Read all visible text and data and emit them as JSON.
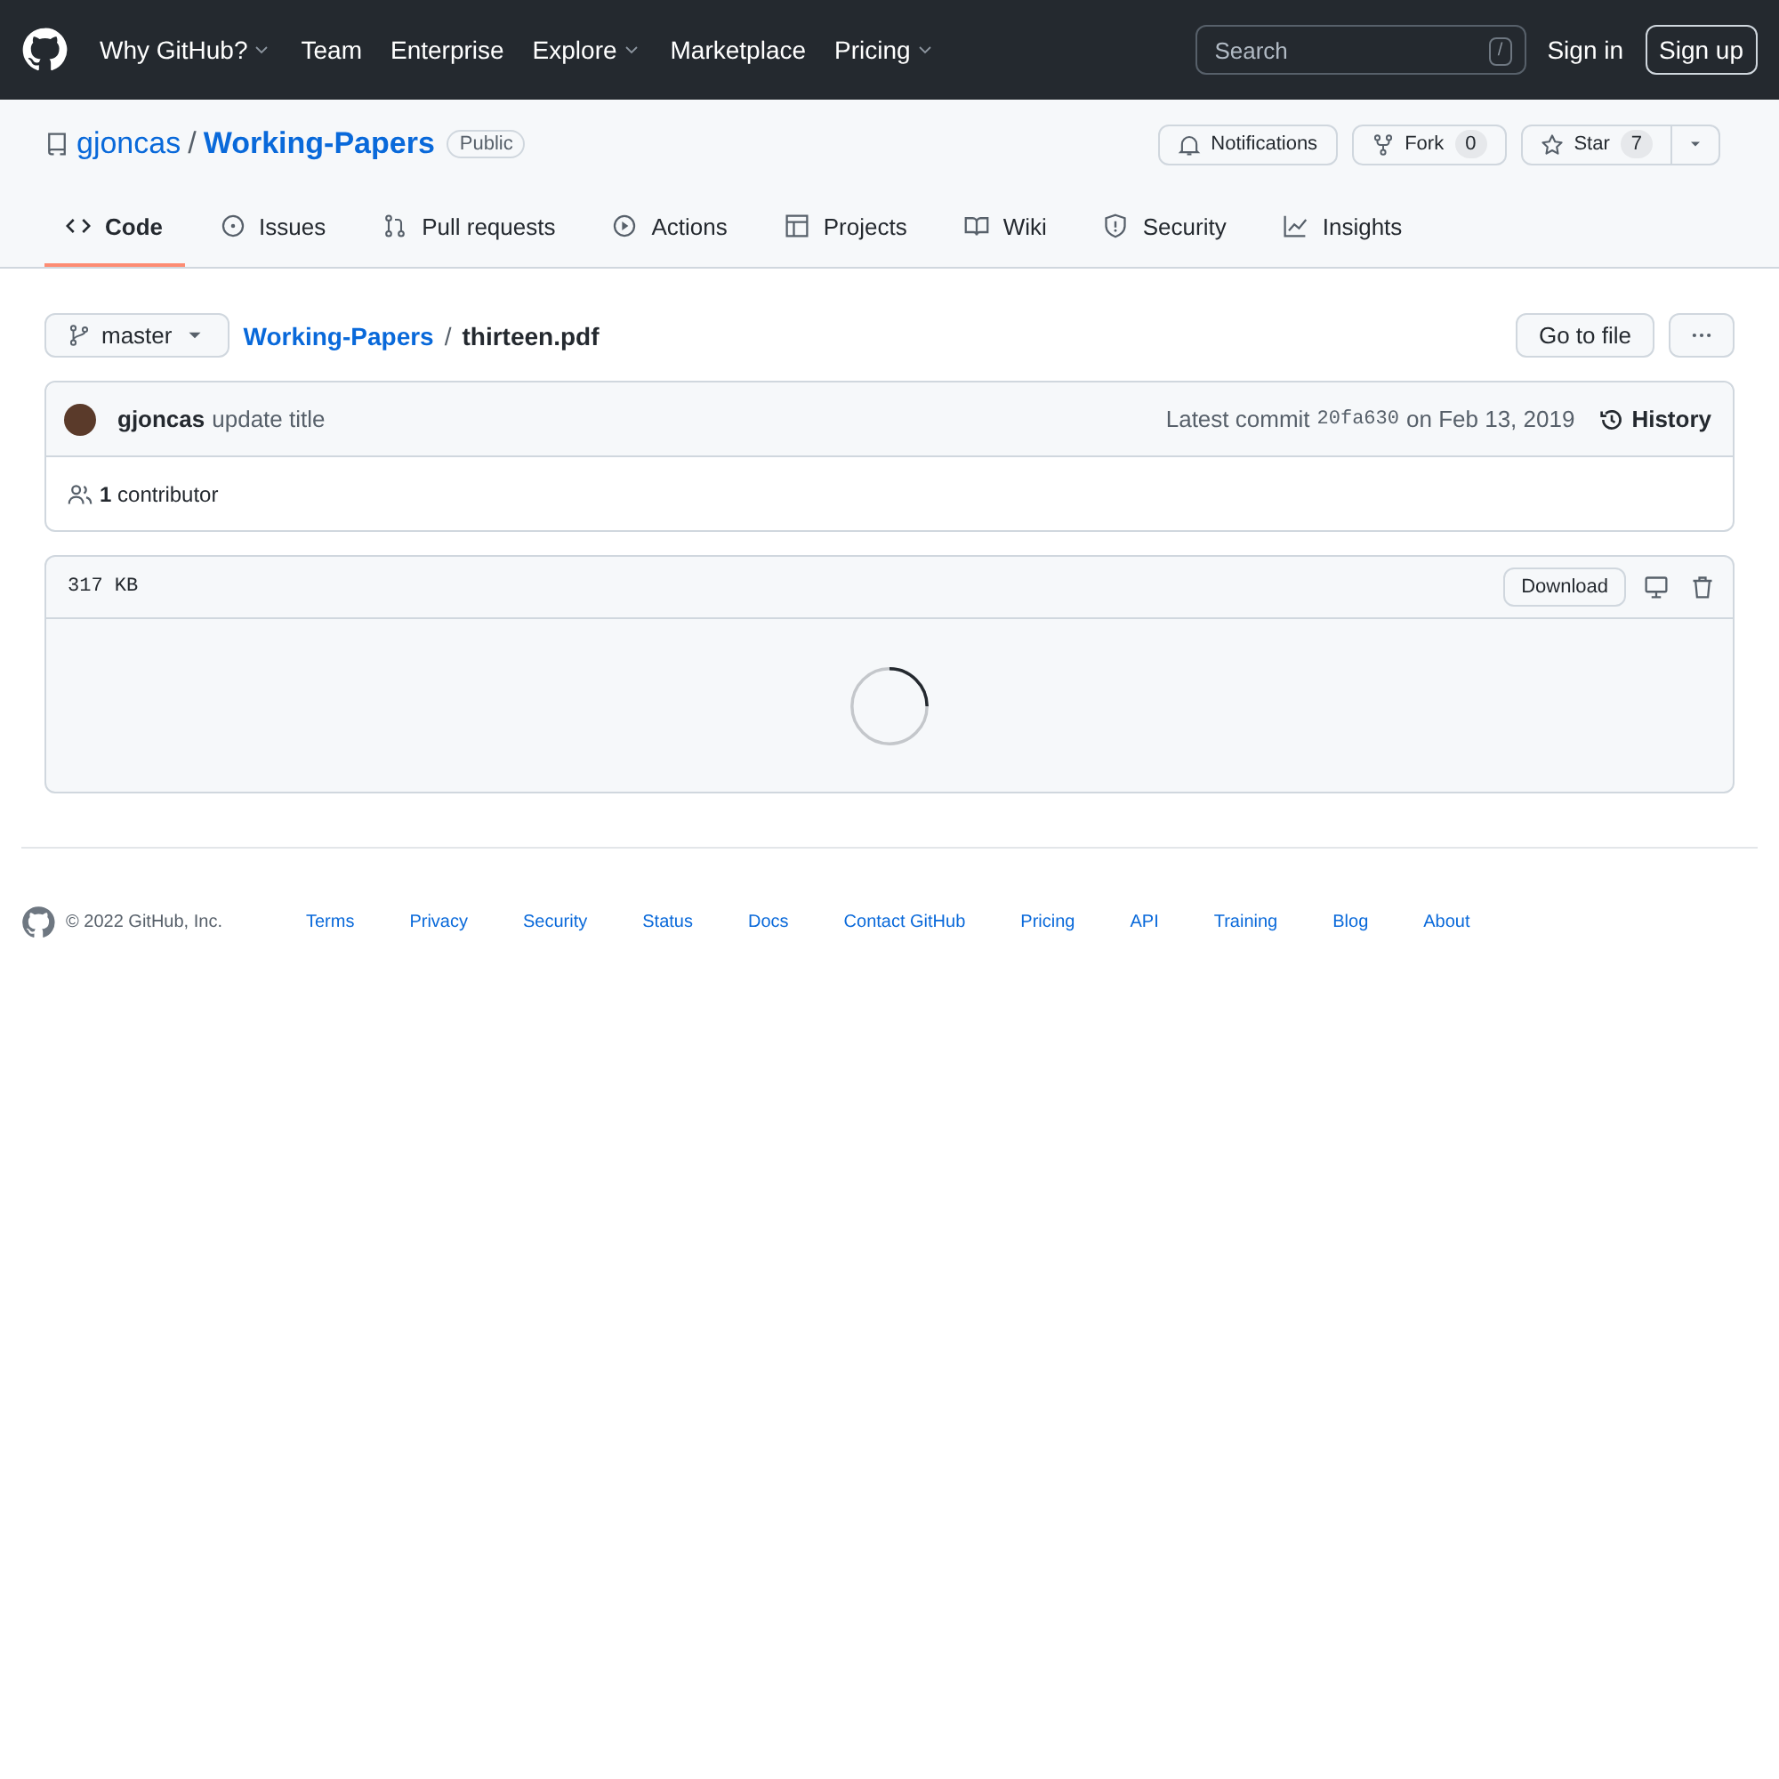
{
  "header": {
    "nav": [
      {
        "label": "Why GitHub?",
        "has_menu": true
      },
      {
        "label": "Team",
        "has_menu": false
      },
      {
        "label": "Enterprise",
        "has_menu": false
      },
      {
        "label": "Explore",
        "has_menu": true
      },
      {
        "label": "Marketplace",
        "has_menu": false
      },
      {
        "label": "Pricing",
        "has_menu": true
      }
    ],
    "search": {
      "placeholder": "Search",
      "shortcut": "/"
    },
    "sign_in": "Sign in",
    "sign_up": "Sign up"
  },
  "repo": {
    "owner": "gjoncas",
    "separator": "/",
    "name": "Working-Papers",
    "visibility": "Public",
    "notifications": "Notifications",
    "fork": {
      "label": "Fork",
      "count": "0"
    },
    "star": {
      "label": "Star",
      "count": "7"
    }
  },
  "tabs": [
    {
      "label": "Code",
      "kind": "code",
      "selected": true
    },
    {
      "label": "Issues",
      "kind": "issue",
      "selected": false
    },
    {
      "label": "Pull requests",
      "kind": "pull",
      "selected": false
    },
    {
      "label": "Actions",
      "kind": "play",
      "selected": false
    },
    {
      "label": "Projects",
      "kind": "table",
      "selected": false
    },
    {
      "label": "Wiki",
      "kind": "book",
      "selected": false
    },
    {
      "label": "Security",
      "kind": "shield",
      "selected": false
    },
    {
      "label": "Insights",
      "kind": "graph",
      "selected": false
    }
  ],
  "breadcrumb": {
    "branch": "master",
    "repo": "Working-Papers",
    "separator": "/",
    "file": "thirteen.pdf",
    "go_to_file": "Go to file"
  },
  "commit": {
    "author": "gjoncas",
    "message": "update title",
    "prefix": "Latest commit",
    "sha": "20fa630",
    "date": "on Feb 13, 2019",
    "history": "History"
  },
  "contributors": {
    "count": "1",
    "label": "contributor"
  },
  "file": {
    "size": "317 KB",
    "download": "Download"
  },
  "footer": {
    "copyright": "© 2022 GitHub, Inc.",
    "links": [
      "Terms",
      "Privacy",
      "Security",
      "Status",
      "Docs",
      "Contact GitHub",
      "Pricing",
      "API",
      "Training",
      "Blog",
      "About"
    ]
  }
}
